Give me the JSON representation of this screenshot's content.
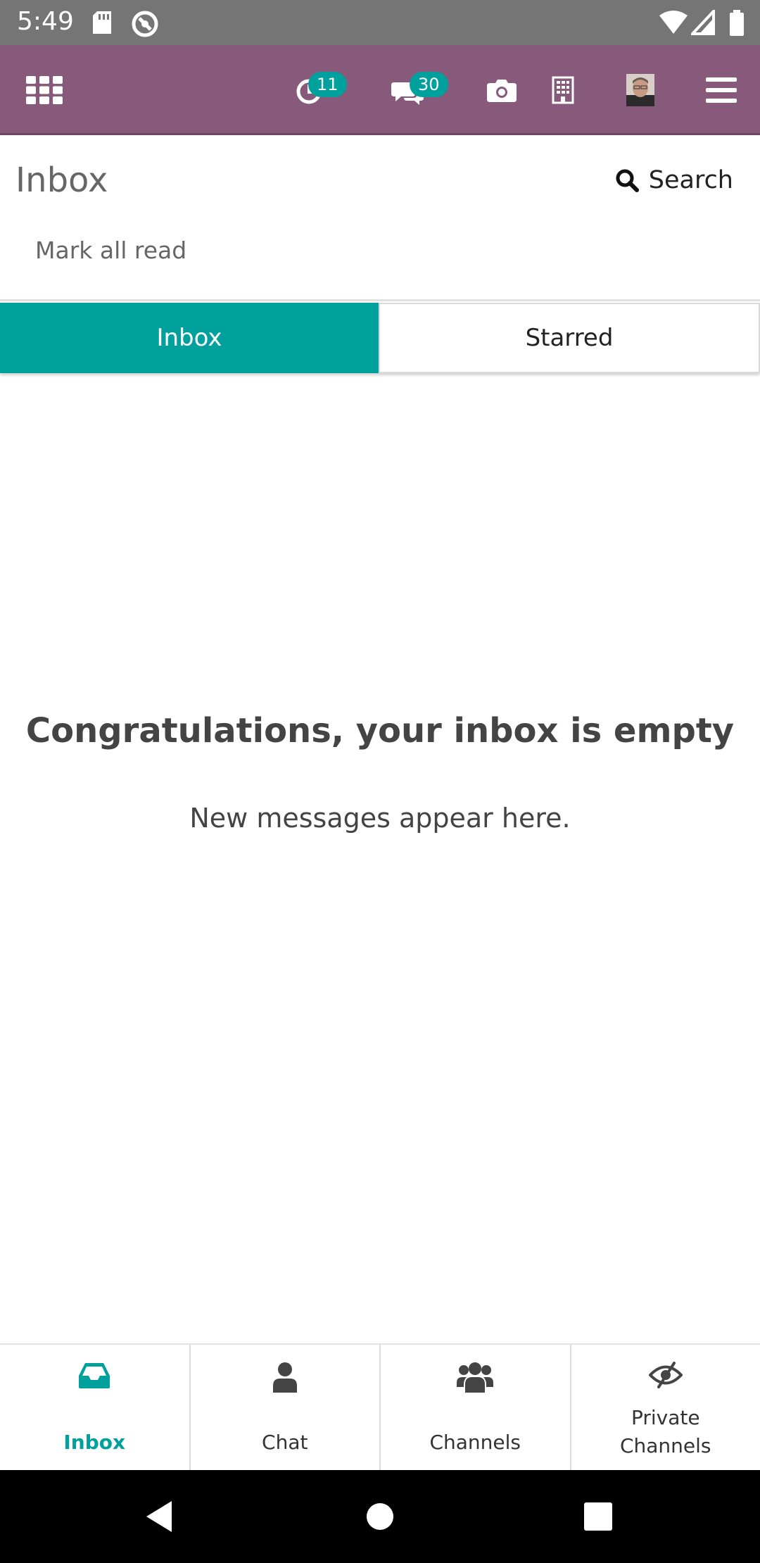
{
  "status_bar": {
    "time": "5:49"
  },
  "app_bar": {
    "activity_count": "11",
    "messages_count": "30"
  },
  "control_panel": {
    "title": "Inbox",
    "search_label": "Search",
    "mark_all_read": "Mark all read"
  },
  "tabs": [
    {
      "label": "Inbox",
      "active": true
    },
    {
      "label": "Starred",
      "active": false
    }
  ],
  "empty_state": {
    "title": "Congratulations, your inbox is empty",
    "subtitle": "New messages appear here."
  },
  "bottom_nav": [
    {
      "label": "Inbox",
      "icon": "inbox-icon",
      "active": true
    },
    {
      "label": "Chat",
      "icon": "user-icon",
      "active": false
    },
    {
      "label": "Channels",
      "icon": "users-icon",
      "active": false
    },
    {
      "label": "Private Channels",
      "icon": "eye-slash-icon",
      "active": false
    }
  ],
  "colors": {
    "brand": "#875a7b",
    "accent": "#00a09d",
    "status_bar": "#757575"
  }
}
